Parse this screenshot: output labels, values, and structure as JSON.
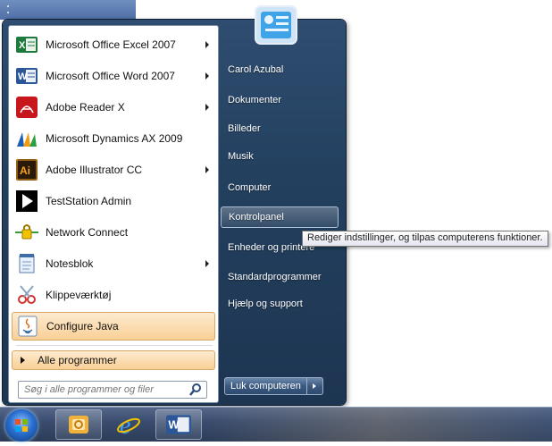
{
  "start_menu": {
    "programs": [
      {
        "label": "Microsoft Office Excel 2007",
        "icon": "excel-icon",
        "has_submenu": true
      },
      {
        "label": "Microsoft Office Word 2007",
        "icon": "word-icon",
        "has_submenu": true
      },
      {
        "label": "Adobe Reader X",
        "icon": "adobe-reader-icon",
        "has_submenu": true
      },
      {
        "label": "Microsoft Dynamics AX 2009",
        "icon": "dynamics-icon",
        "has_submenu": false
      },
      {
        "label": "Adobe Illustrator CC",
        "icon": "illustrator-icon",
        "has_submenu": true
      },
      {
        "label": "TestStation Admin",
        "icon": "play-icon",
        "has_submenu": false
      },
      {
        "label": "Network Connect",
        "icon": "network-lock-icon",
        "has_submenu": false
      },
      {
        "label": "Notesblok",
        "icon": "notepad-icon",
        "has_submenu": true
      },
      {
        "label": "Klippeværktøj",
        "icon": "scissors-icon",
        "has_submenu": false
      },
      {
        "label": "Configure Java",
        "icon": "java-icon",
        "has_submenu": false
      }
    ],
    "all_programs_label": "Alle programmer",
    "search_placeholder": "Søg i alle programmer og filer",
    "right_links": [
      "Carol Azubal",
      "Dokumenter",
      "Billeder",
      "Musik",
      "Computer",
      "Kontrolpanel",
      "Enheder og printere",
      "Standardprogrammer",
      "Hjælp og support"
    ],
    "shutdown_label": "Luk computeren",
    "tooltip": "Rediger indstillinger, og tilpas computerens funktioner."
  },
  "taskbar": {
    "pinned": [
      "outlook-icon",
      "internet-explorer-icon",
      "word-icon"
    ]
  },
  "colors": {
    "highlight": "#f9cf95",
    "menu_frame": "#23405f",
    "taskbar": "#3a4d6f"
  }
}
